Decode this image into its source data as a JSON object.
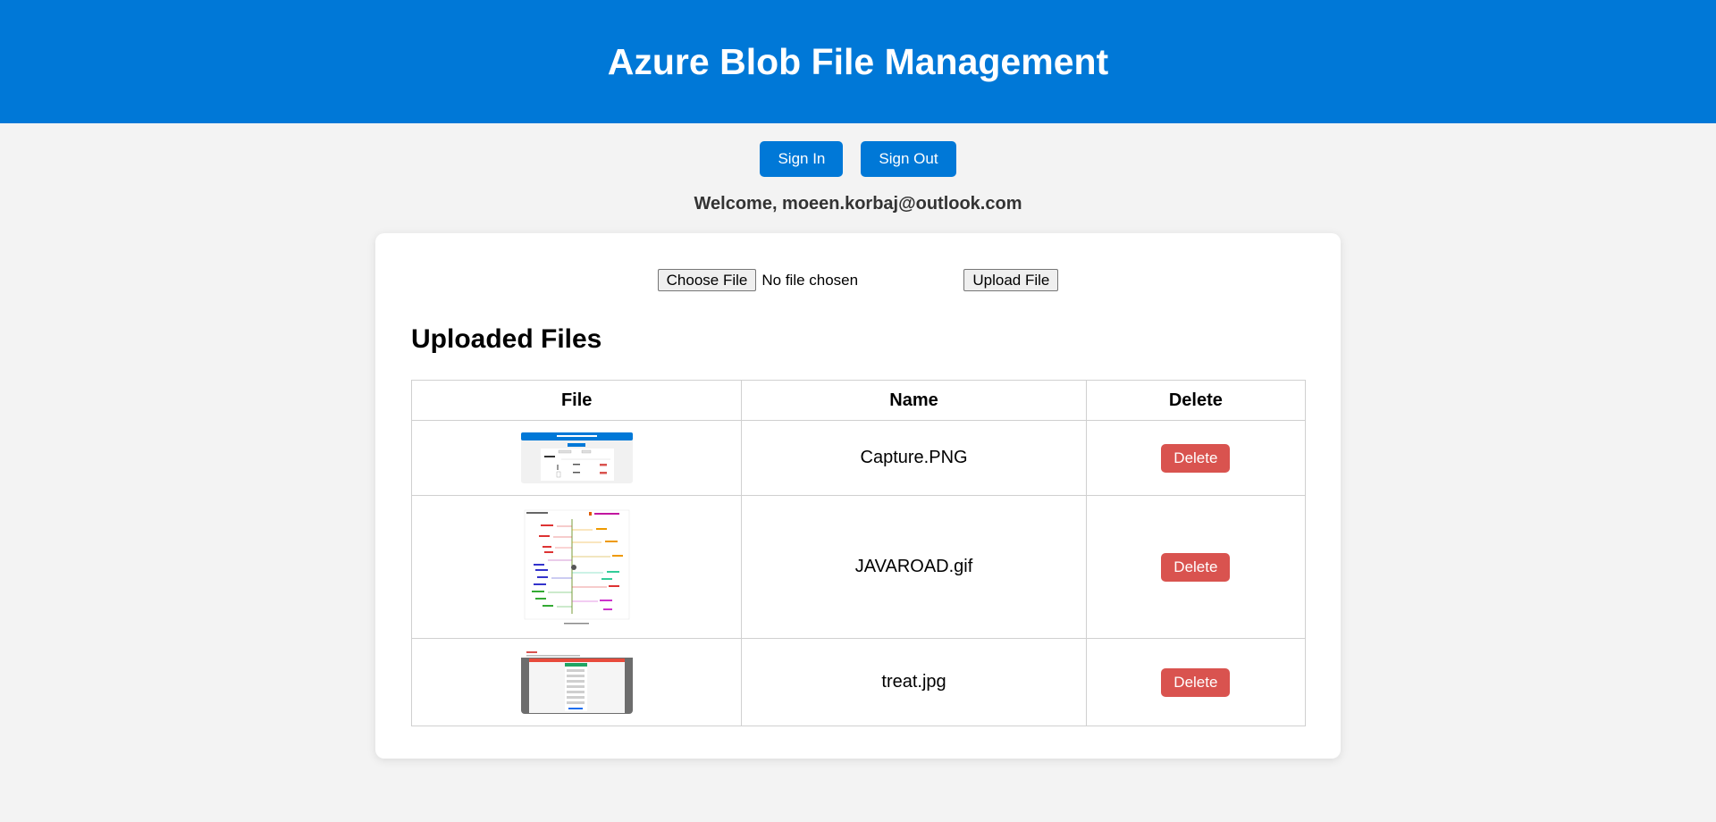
{
  "header": {
    "title": "Azure Blob File Management"
  },
  "auth": {
    "sign_in_label": "Sign In",
    "sign_out_label": "Sign Out"
  },
  "welcome": {
    "text": "Welcome, moeen.korbaj@outlook.com"
  },
  "upload": {
    "choose_label": "Choose File",
    "status_text": "No file chosen",
    "upload_label": "Upload File"
  },
  "files_section": {
    "title": "Uploaded Files",
    "columns": [
      "File",
      "Name",
      "Delete"
    ],
    "rows": [
      {
        "name": "Capture.PNG",
        "delete_label": "Delete",
        "thumbnail": "capture-screenshot-thumbnail"
      },
      {
        "name": "JAVAROAD.gif",
        "delete_label": "Delete",
        "thumbnail": "java-roadmap-thumbnail"
      },
      {
        "name": "treat.jpg",
        "delete_label": "Delete",
        "thumbnail": "browser-form-thumbnail"
      }
    ]
  },
  "colors": {
    "brand": "#0078d7",
    "danger": "#d9534f",
    "page_bg": "#f3f3f3"
  }
}
